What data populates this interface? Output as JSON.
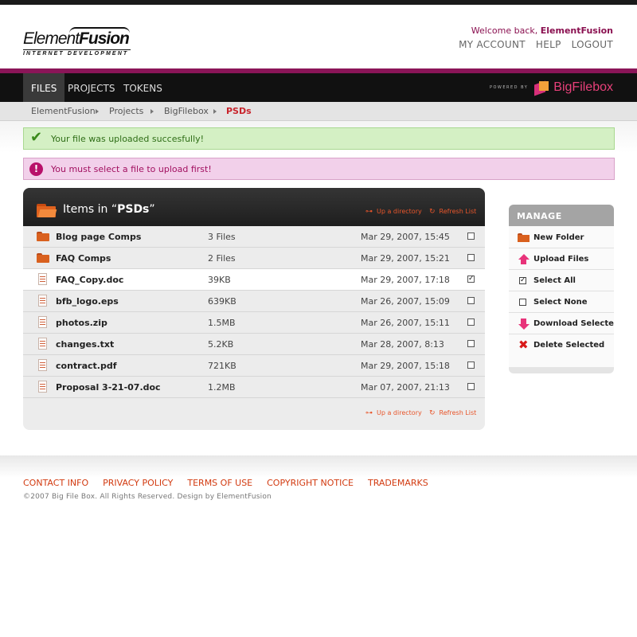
{
  "header": {
    "logo_main_a": "Element",
    "logo_main_b": "Fusion",
    "logo_sub": "INTERNET DEVELOPMENT",
    "welcome_prefix": "Welcome back, ",
    "welcome_user": "ElementFusion",
    "links": [
      "MY ACCOUNT",
      "HELP",
      "LOGOUT"
    ]
  },
  "nav": {
    "tabs": [
      "FILES",
      "PROJECTS",
      "TOKENS"
    ],
    "active": "FILES",
    "powered_by": "POWERED BY",
    "brand": "BigFilebox"
  },
  "breadcrumb": [
    "ElementFusion",
    "Projects",
    "BigFilebox",
    "PSDs"
  ],
  "alerts": {
    "success": "Your file was uploaded succesfully!",
    "error": "You must select a file to upload first!"
  },
  "panel": {
    "title_prefix": "Items in “",
    "title_folder": "PSDs",
    "title_suffix": "”",
    "up_directory": "Up a directory",
    "refresh_list": "Refresh List",
    "files": [
      {
        "name": "Blog page Comps",
        "size": "3 Files",
        "date": "Mar 29, 2007, 15:45",
        "type": "folder",
        "checked": false
      },
      {
        "name": "FAQ Comps",
        "size": "2 Files",
        "date": "Mar 29, 2007, 15:21",
        "type": "folder",
        "checked": false
      },
      {
        "name": "FAQ_Copy.doc",
        "size": "39KB",
        "date": "Mar 29, 2007, 17:18",
        "type": "file",
        "checked": true
      },
      {
        "name": "bfb_logo.eps",
        "size": "639KB",
        "date": "Mar 26, 2007, 15:09",
        "type": "file",
        "checked": false
      },
      {
        "name": "photos.zip",
        "size": "1.5MB",
        "date": "Mar 26, 2007, 15:11",
        "type": "file",
        "checked": false
      },
      {
        "name": "changes.txt",
        "size": "5.2KB",
        "date": "Mar 28, 2007, 8:13",
        "type": "file",
        "checked": false
      },
      {
        "name": "contract.pdf",
        "size": "721KB",
        "date": "Mar 29, 2007, 15:18",
        "type": "file",
        "checked": false
      },
      {
        "name": "Proposal 3-21-07.doc",
        "size": "1.2MB",
        "date": "Mar 07, 2007, 21:13",
        "type": "file",
        "checked": false
      }
    ]
  },
  "manage": {
    "title": "MANAGE",
    "items": [
      {
        "label": "New Folder",
        "icon": "folder-icon"
      },
      {
        "label": "Upload Files",
        "icon": "upload-arrow-icon"
      },
      {
        "label": "Select All",
        "icon": "checked-box-icon"
      },
      {
        "label": "Select None",
        "icon": "empty-box-icon"
      },
      {
        "label": "Download Selected",
        "icon": "download-arrow-icon"
      },
      {
        "label": "Delete Selected",
        "icon": "delete-x-icon"
      }
    ]
  },
  "footer": {
    "links": [
      "CONTACT INFO",
      "PRIVACY POLICY",
      "TERMS OF USE",
      "COPYRIGHT NOTICE",
      "TRADEMARKS"
    ],
    "copyright": "©2007 Big File Box. All Rights Reserved. Design by ElementFusion"
  },
  "colors": {
    "accent": "#8b1558",
    "link_orange": "#d23a10",
    "success_bg": "#d4f0c4",
    "error_bg": "#f2d0ea"
  }
}
